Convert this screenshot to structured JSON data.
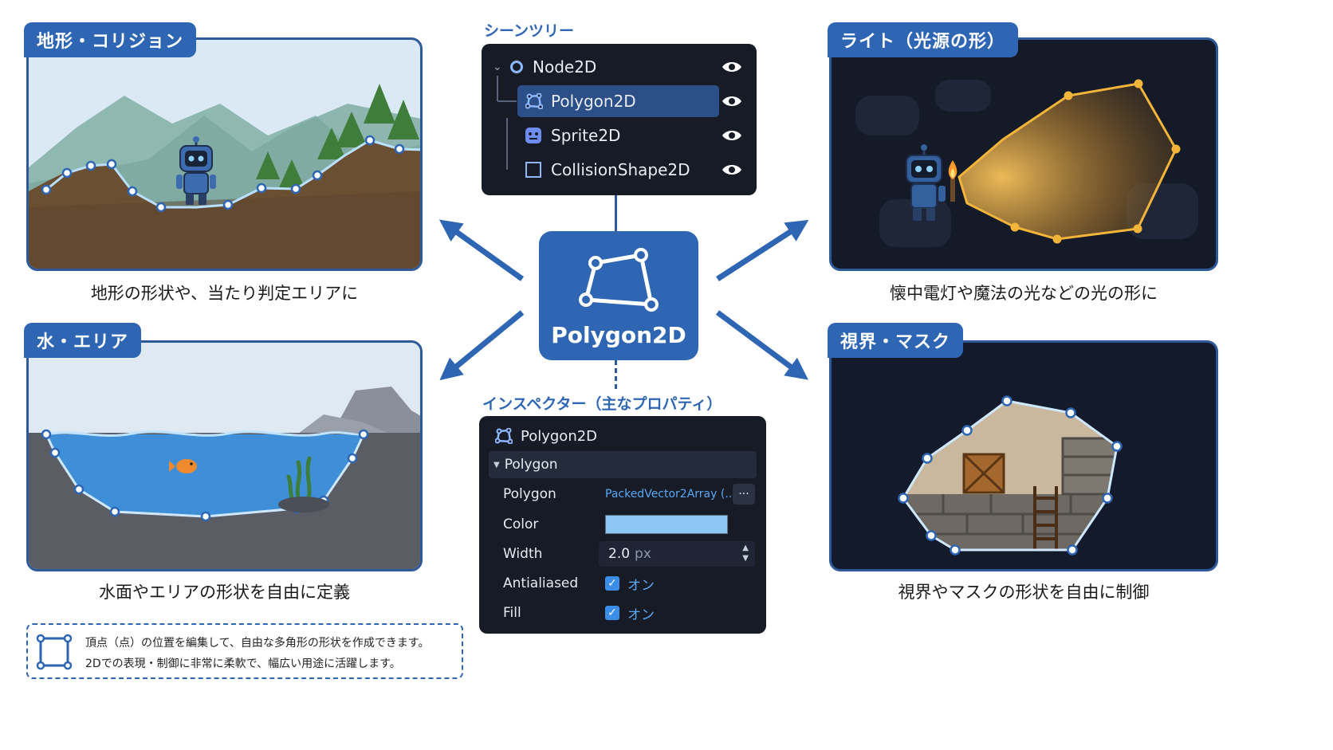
{
  "panels": {
    "terrain": {
      "tag": "地形・コリジョン",
      "caption": "地形の形状や、当たり判定エリアに"
    },
    "light": {
      "tag": "ライト（光源の形）",
      "caption": "懐中電灯や魔法の光などの光の形に"
    },
    "water": {
      "tag": "水・エリア",
      "caption": "水面やエリアの形状を自由に定義"
    },
    "vision": {
      "tag": "視界・マスク",
      "caption": "視界やマスクの形状を自由に制御"
    }
  },
  "scene_tree": {
    "title": "シーンツリー",
    "items": [
      {
        "label": "Node2D",
        "icon": "circle-icon"
      },
      {
        "label": "Polygon2D",
        "icon": "polygon-icon",
        "selected": true
      },
      {
        "label": "Sprite2D",
        "icon": "sprite-icon"
      },
      {
        "label": "CollisionShape2D",
        "icon": "square-icon"
      }
    ]
  },
  "center": {
    "label": "Polygon2D"
  },
  "inspector": {
    "title": "インスペクター（主なプロパティ）",
    "header": "Polygon2D",
    "section": "Polygon",
    "rows": {
      "polygon": {
        "label": "Polygon",
        "value": "PackedVector2Array (...)",
        "more": "···"
      },
      "color": {
        "label": "Color",
        "swatch": "#8cc6f2"
      },
      "width": {
        "label": "Width",
        "value": "2.0",
        "unit": "px"
      },
      "antialiased": {
        "label": "Antialiased",
        "value": "オン"
      },
      "fill": {
        "label": "Fill",
        "value": "オン"
      }
    }
  },
  "note": {
    "line1": "頂点（点）の位置を編集して、自由な多角形の形状を作成できます。",
    "line2": "2Dでの表現・制御に非常に柔軟で、幅広い用途に活躍します。"
  },
  "colors": {
    "accent": "#2e66b3",
    "dark_panel": "#161b26",
    "selection": "#2b4f86"
  }
}
